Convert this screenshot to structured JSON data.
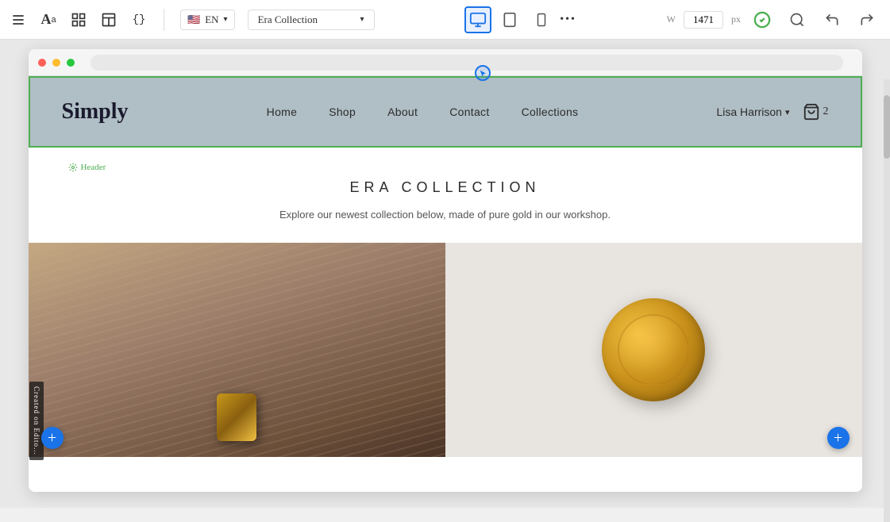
{
  "toolbar": {
    "icons": {
      "text": "A",
      "font": "Aa",
      "grid": "⊞",
      "layout": "▦",
      "code": "{}"
    },
    "language": {
      "flag": "🇺🇸",
      "code": "EN",
      "chevron": "▾"
    },
    "page_selector": {
      "label": "Era Collection",
      "chevron": "▾"
    },
    "devices": [
      {
        "name": "desktop",
        "icon": "🖥",
        "active": true
      },
      {
        "name": "tablet",
        "icon": "⬜",
        "active": false
      },
      {
        "name": "mobile",
        "icon": "📱",
        "active": false
      }
    ],
    "more_icon": "•••",
    "width_label": "W",
    "width_value": "1471",
    "width_unit": "px",
    "actions": {
      "check": "✓",
      "search": "🔍",
      "undo": "↩",
      "redo": "↪"
    }
  },
  "header_label": "Header",
  "site": {
    "logo": "Simply",
    "nav": [
      {
        "label": "Home"
      },
      {
        "label": "Shop"
      },
      {
        "label": "About"
      },
      {
        "label": "Contact"
      },
      {
        "label": "Collections"
      }
    ],
    "user": {
      "name": "Lisa Harrison",
      "chevron": "▾"
    },
    "cart": {
      "count": "2"
    }
  },
  "hero": {
    "title": "ERA COLLECTION",
    "subtitle": "Explore our newest collection below, made of pure gold in our workshop."
  },
  "add_section_labels": [
    "+",
    "+"
  ],
  "watermark": "Created on Edito..."
}
